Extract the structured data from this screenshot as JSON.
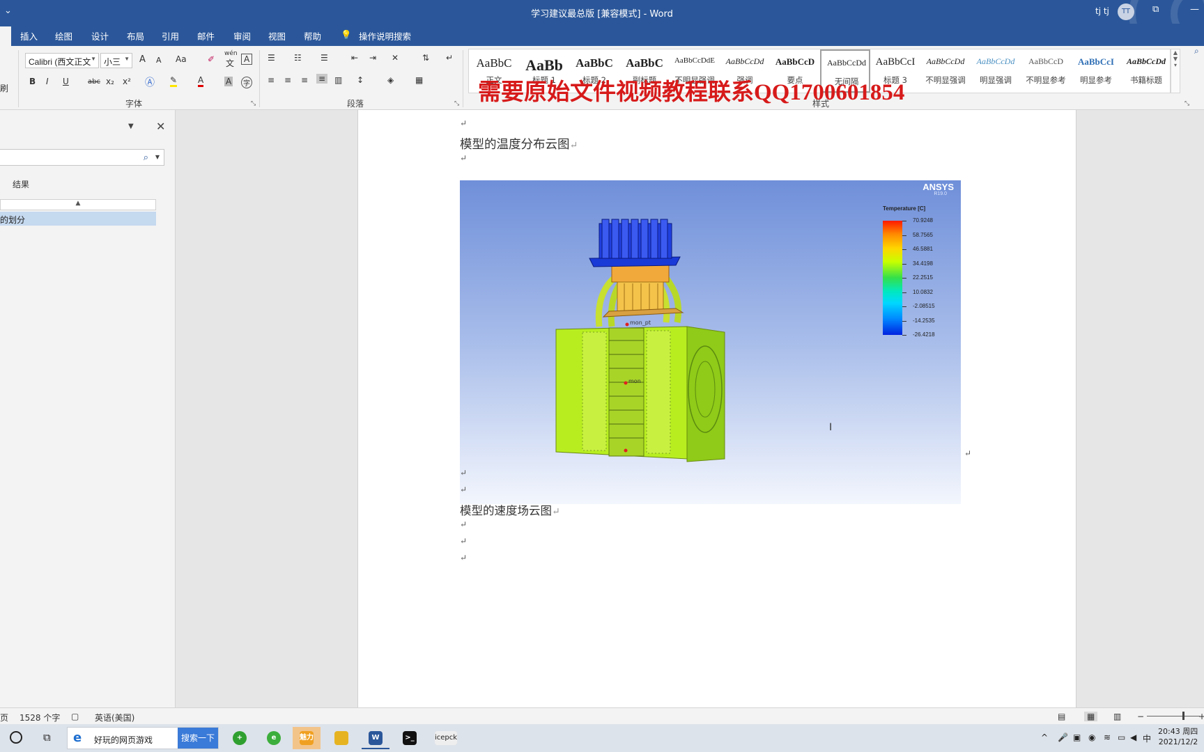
{
  "titlebar": {
    "title": "学习建议最总版 [兼容模式]  -  Word",
    "user": "tj tj",
    "avatar": "TT",
    "restore_icon": "restore-window-icon",
    "qa_icon": "customize-quick-access-icon"
  },
  "tabs": [
    "插入",
    "绘图",
    "设计",
    "布局",
    "引用",
    "邮件",
    "审阅",
    "视图",
    "帮助"
  ],
  "tell_me": "操作说明搜索",
  "ribbon": {
    "clipboard_label": "刷",
    "font_name": "Calibri (西文正文",
    "font_size": "小三",
    "font_group": "字体",
    "paragraph_group": "段落",
    "styles_group": "样式",
    "change_case": "Aa",
    "wen_label": "wén",
    "wen_char": "文",
    "border_a": "A",
    "bold": "B",
    "italic": "I",
    "underline": "U",
    "strike": "abc",
    "subscript": "x₂",
    "superscript": "x²",
    "font_color": "A",
    "shading": "A",
    "grow": "A",
    "shrink": "A",
    "circle_char": "字"
  },
  "styles": [
    {
      "preview": "AaBbC",
      "name": "正文",
      "size": 17
    },
    {
      "preview": "AaBb",
      "name": "标题 1",
      "size": 22,
      "bold": true
    },
    {
      "preview": "AaBbC",
      "name": "标题 2",
      "size": 17,
      "bold": true
    },
    {
      "preview": "AaBbC",
      "name": "副标题",
      "size": 17,
      "bold": true
    },
    {
      "preview": "AaBbCcDdE",
      "name": "不明显强调",
      "size": 11
    },
    {
      "preview": "AaBbCcDd",
      "name": "强调",
      "size": 12,
      "italic": true
    },
    {
      "preview": "AaBbCcD",
      "name": "要点",
      "size": 13,
      "bold": true
    },
    {
      "preview": "AaBbCcDd",
      "name": "无间隔",
      "size": 12,
      "selected": true
    },
    {
      "preview": "AaBbCcI",
      "name": "标题 3",
      "size": 15
    },
    {
      "preview": "AaBbCcDd",
      "name": "不明显强调",
      "size": 12,
      "italic": true
    },
    {
      "preview": "AaBbCcDd",
      "name": "明显强调",
      "size": 12,
      "italic": true,
      "color": "#4a90c2"
    },
    {
      "preview": "AaBbCcD",
      "name": "不明显参考",
      "size": 12,
      "color": "#555"
    },
    {
      "preview": "AaBbCcI",
      "name": "明显参考",
      "size": 13,
      "bold": true,
      "color": "#2f6fb5"
    },
    {
      "preview": "AaBbCcDd",
      "name": "书籍标题",
      "size": 12,
      "bold": true,
      "italic": true
    }
  ],
  "watermark": "需要原始文件视频教程联系QQ1700601854",
  "navpane": {
    "results_label": "结果",
    "item": "的划分",
    "head_icon": "collapse-up-icon"
  },
  "document": {
    "para_mark": "↵",
    "heading1": "模型的温度分布云图",
    "heading2": "模型的速度场云图"
  },
  "figure": {
    "logo": "ANSYS",
    "version": "R19.0",
    "legend_title": "Temperature [C]",
    "legend_values": [
      "70.9248",
      "58.7565",
      "46.5881",
      "34.4198",
      "22.2515",
      "10.0832",
      "-2.08515",
      "-14.2535",
      "-26.4218"
    ],
    "labels": [
      "mon_pt",
      "mon"
    ]
  },
  "statusbar": {
    "page": "页",
    "words": "1528 个字",
    "language": "英语(美国)",
    "zoom_minus": "−",
    "zoom_plus": "+"
  },
  "taskbar": {
    "search_text": "好玩的网页游戏",
    "search_button": "搜索一下",
    "apps": [
      {
        "label": "+",
        "color": "#2fa02f"
      },
      {
        "label": "e",
        "color": "#3cae3c"
      },
      {
        "label": "魅力",
        "color": "#f0a020"
      },
      {
        "label": "",
        "color": "#e6b422"
      },
      {
        "label": "W",
        "color": "#2b579a"
      },
      {
        "label": ">_",
        "color": "#111"
      },
      {
        "label": "icepck",
        "color": "#eee"
      }
    ],
    "ime": "中",
    "time": "20:43 周四",
    "date": "2021/12/2"
  }
}
